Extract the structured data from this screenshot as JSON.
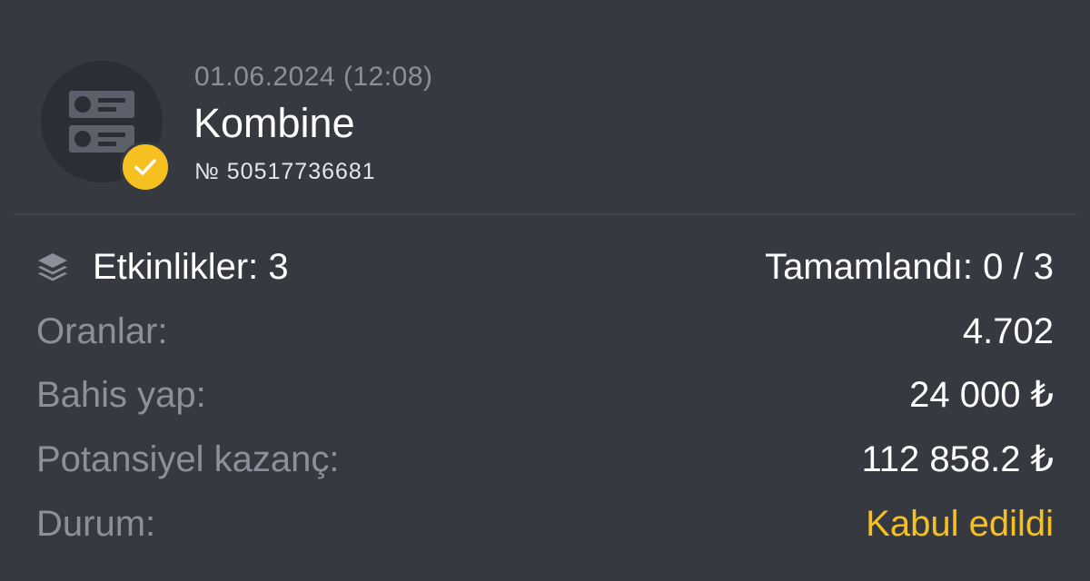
{
  "header": {
    "date": "01.06.2024 (12:08)",
    "bet_type": "Kombine",
    "bet_number": "№ 50517736681",
    "avatar_icon": "ticket-icon",
    "badge_icon": "check-icon",
    "badge_color": "#f6c120"
  },
  "details": {
    "events_label": "Etkinlikler: 3",
    "events_icon": "layers-icon",
    "completed": "Tamamlandı: 0 / 3",
    "odds_label": "Oranlar:",
    "odds_value": "4.702",
    "stake_label": "Bahis yap:",
    "stake_value": "24 000 ₺",
    "potential_label": "Potansiyel kazanç:",
    "potential_value": "112 858.2 ₺",
    "status_label": "Durum:",
    "status_value": "Kabul edildi",
    "status_color": "#f6c120"
  },
  "colors": {
    "background": "#363940",
    "muted_text": "#8b909a",
    "primary_text": "#ffffff"
  }
}
